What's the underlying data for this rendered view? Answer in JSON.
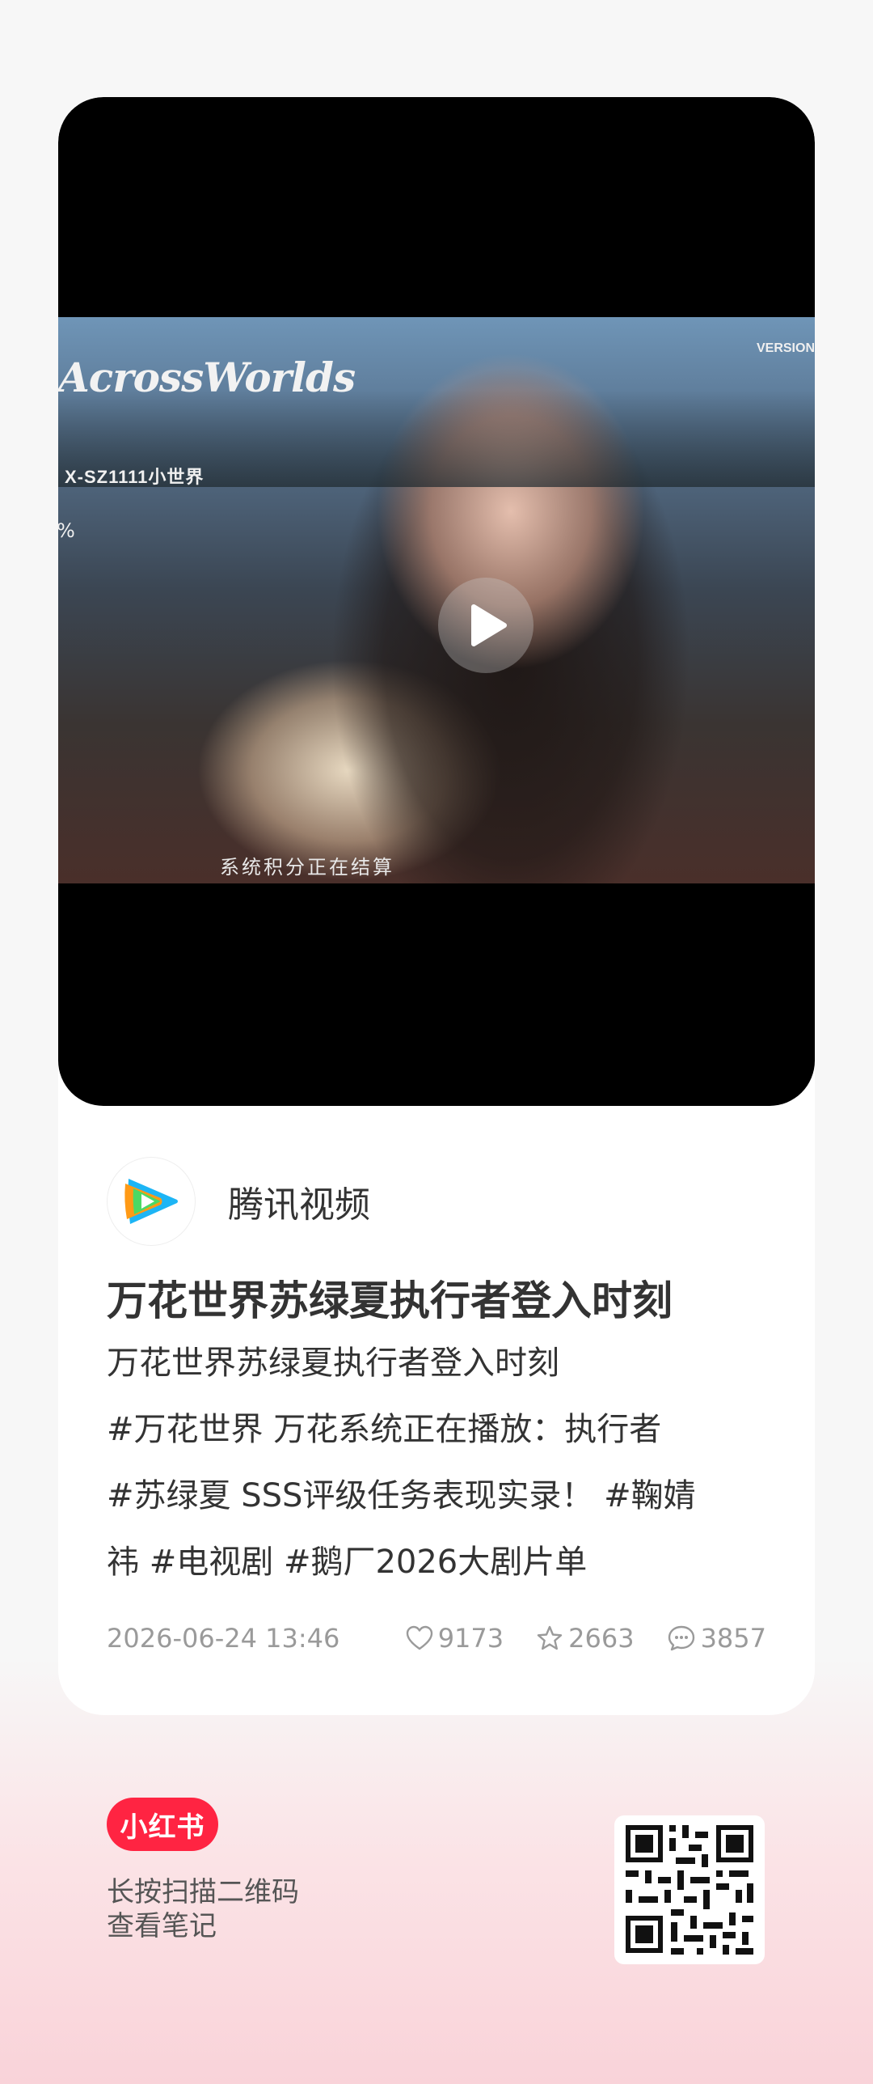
{
  "video": {
    "overlay_logo": "AcrossWorlds",
    "overlay_code": "X-SZ1111小世界",
    "overlay_percent": "%",
    "overlay_version": "VERSION",
    "subtitle": "系统积分正在结算",
    "play_icon": "play-icon"
  },
  "author": {
    "name": "腾讯视频",
    "avatar_icon": "tencent-video-logo-icon"
  },
  "post": {
    "title": "万花世界苏绿夏执行者登入时刻",
    "desc_line1": "万花世界苏绿夏执行者登入时刻",
    "desc_line2": "#万花世界 万花系统正在播放：执行者",
    "desc_line3": "#苏绿夏 SSS评级任务表现实录！ #鞠婧",
    "desc_line4": "祎 #电视剧 #鹅厂2026大剧片单"
  },
  "meta": {
    "date": "2026-06-24 13:46",
    "likes": "9173",
    "collects": "2663",
    "comments": "3857"
  },
  "footer": {
    "brand": "小红书",
    "scan_line1": "长按扫描二维码",
    "scan_line2": "查看笔记"
  },
  "colors": {
    "brand_red": "#ff2442",
    "meta_gray": "#9a9a9a"
  }
}
